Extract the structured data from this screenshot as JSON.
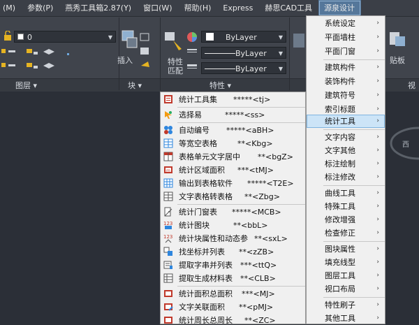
{
  "menubar": {
    "items": [
      "(M)",
      "参数(P)",
      "燕秀工具箱2.87(Y)",
      "窗口(W)",
      "帮助(H)",
      "Express",
      "赫思CAD工具",
      "源泉设计"
    ]
  },
  "ribbon": {
    "layer_combo_value": "0",
    "panel_layers": "图层",
    "panel_block": "块",
    "panel_properties": "特性",
    "insert_label": "插入",
    "match_label_1": "特性",
    "match_label_2": "匹配",
    "color_value": "ByLayer",
    "linetype_value": "ByLayer",
    "lineweight_value": "ByLayer",
    "right_partial_1": "贴板",
    "right_partial_2": "视",
    "right_partial_3": "西"
  },
  "submenu": {
    "items": [
      {
        "label": "统计工具集",
        "cmd": "*****<tj>",
        "icon": "stats-tools-icon"
      },
      {
        "label": "选择易",
        "cmd": "*****<ss>",
        "icon": "select-icon"
      },
      {
        "label": "自动编号",
        "cmd": "*****<aBH>",
        "icon": "auto-number-icon"
      },
      {
        "label": "等宽空表格",
        "cmd": "**<Kbg>",
        "icon": "empty-table-icon"
      },
      {
        "label": "表格单元文字居中",
        "cmd": "**<bgZ>",
        "icon": "table-center-icon"
      },
      {
        "label": "统计区域面积",
        "cmd": "***<tMJ>",
        "icon": "area-stats-icon"
      },
      {
        "label": "输出到表格软件",
        "cmd": "*****<T2E>",
        "icon": "export-table-icon"
      },
      {
        "label": "文字表格转表格",
        "cmd": "**<Zbg>",
        "icon": "text-to-table-icon"
      },
      {
        "label": "统计门窗表",
        "cmd": "*****<MCB>",
        "icon": "door-window-icon"
      },
      {
        "label": "统计图块",
        "cmd": "**<bbL>",
        "icon": "block-count-icon"
      },
      {
        "label": "统计块属性和动态参",
        "cmd": "**<sxL>",
        "icon": "block-attr-icon"
      },
      {
        "label": "找坐标并列表",
        "cmd": "**<zZB>",
        "icon": "coord-list-icon"
      },
      {
        "label": "提取字串并列表",
        "cmd": "***<ttQ>",
        "icon": "string-list-icon"
      },
      {
        "label": "提取生成材料表",
        "cmd": "**<CLB>",
        "icon": "material-table-icon"
      },
      {
        "label": "统计面积总面积",
        "cmd": "***<MJ>",
        "icon": "total-area-icon"
      },
      {
        "label": "文字关联面积",
        "cmd": "**<pMJ>",
        "icon": "text-area-link-icon"
      },
      {
        "label": "统计周长总周长",
        "cmd": "**<ZC>",
        "icon": "perimeter-icon"
      }
    ]
  },
  "mainmenu": {
    "items": [
      "系统设定",
      "平面墙柱",
      "平面门窗",
      "建筑构件",
      "装饰构件",
      "建筑符号",
      "索引标题",
      "统计工具",
      "文字内容",
      "文字其他",
      "标注绘制",
      "标注修改",
      "曲线工具",
      "特殊工具",
      "修改增强",
      "检查修正",
      "图块属性",
      "填充线型",
      "图层工具",
      "视口布局",
      "特性刷子",
      "其他工具"
    ],
    "chevron": "›"
  },
  "colors": {
    "menubar_bg": "#3b3f47",
    "ribbon_bg": "#40444c",
    "menu_bg": "#f0f0f0",
    "menu_highlight": "#cce4f7",
    "active_menu": "#55779a"
  }
}
